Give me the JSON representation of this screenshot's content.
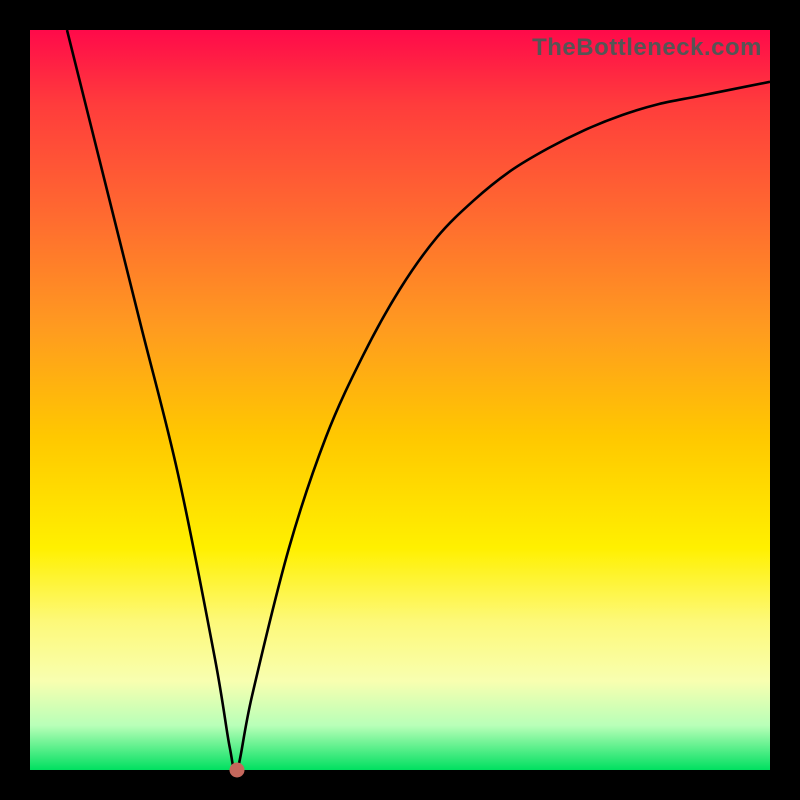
{
  "watermark": "TheBottleneck.com",
  "chart_data": {
    "type": "line",
    "title": "",
    "xlabel": "",
    "ylabel": "",
    "xlim": [
      0,
      100
    ],
    "ylim": [
      0,
      100
    ],
    "series": [
      {
        "name": "curve",
        "x": [
          5,
          10,
          15,
          20,
          25,
          27,
          28,
          30,
          35,
          40,
          45,
          50,
          55,
          60,
          65,
          70,
          75,
          80,
          85,
          90,
          95,
          100
        ],
        "y": [
          100,
          80,
          60,
          40,
          15,
          3,
          0,
          10,
          30,
          45,
          56,
          65,
          72,
          77,
          81,
          84,
          86.5,
          88.5,
          90,
          91,
          92,
          93
        ]
      }
    ],
    "marker": {
      "x": 28,
      "y": 0
    },
    "background": "rainbow-vertical"
  }
}
